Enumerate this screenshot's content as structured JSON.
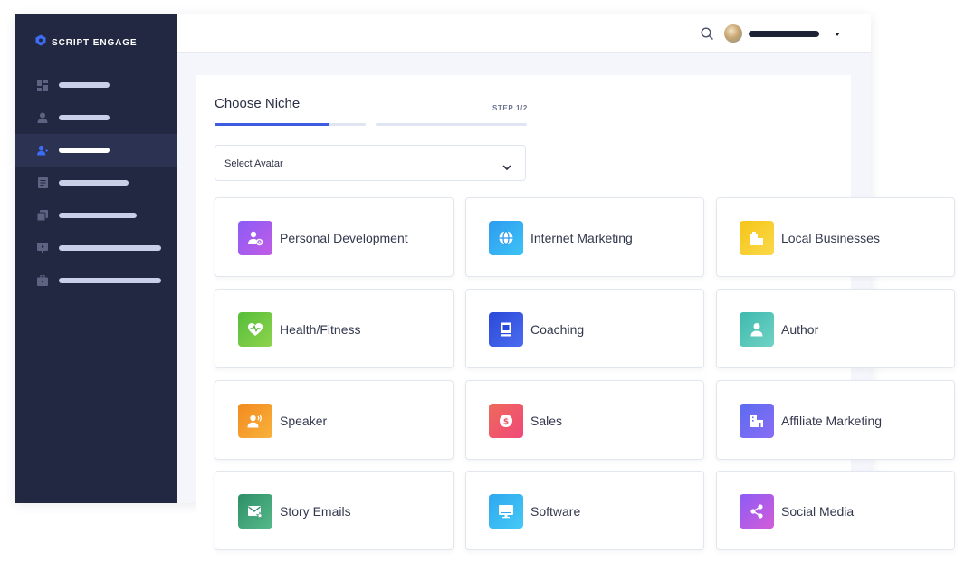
{
  "brand": {
    "name": "SCRIPT ENGAGE",
    "icon": "hexagon-logo-icon",
    "color": "#3d6cf5"
  },
  "sidebar": {
    "items": [
      {
        "icon": "dashboard-icon",
        "active": false
      },
      {
        "icon": "user-icon",
        "active": false
      },
      {
        "icon": "add-user-icon",
        "active": true
      },
      {
        "icon": "document-icon",
        "active": false
      },
      {
        "icon": "copy-icon",
        "active": false
      },
      {
        "icon": "presentation-icon",
        "active": false
      },
      {
        "icon": "briefcase-icon",
        "active": false
      }
    ]
  },
  "header": {
    "search_icon": "search-icon",
    "user_menu_icon": "caret-down-icon"
  },
  "main": {
    "title": "Choose Niche",
    "step_label": "STEP 1/2",
    "progress": [
      0.76,
      0
    ],
    "select": {
      "placeholder": "Select Avatar",
      "icon": "chevron-down-icon"
    },
    "niches": [
      {
        "label": "Personal Development",
        "icon": "user-gear-icon",
        "colors": [
          "#8b5cf6",
          "#c15ce6"
        ]
      },
      {
        "label": "Internet Marketing",
        "icon": "globe-icon",
        "colors": [
          "#2e9bf0",
          "#3cc3f5"
        ]
      },
      {
        "label": "Local Businesses",
        "icon": "building-icon",
        "colors": [
          "#f5c518",
          "#fbd94a"
        ]
      },
      {
        "label": "Health/Fitness",
        "icon": "heart-pulse-icon",
        "colors": [
          "#56bd3a",
          "#8fd44e"
        ]
      },
      {
        "label": "Coaching",
        "icon": "book-icon",
        "colors": [
          "#2b49d8",
          "#4a6cf0"
        ]
      },
      {
        "label": "Author",
        "icon": "person-icon",
        "colors": [
          "#3fb9ae",
          "#6fd3c4"
        ]
      },
      {
        "label": "Speaker",
        "icon": "speaker-person-icon",
        "colors": [
          "#f28a1f",
          "#f8b23c"
        ]
      },
      {
        "label": "Sales",
        "icon": "dollar-coin-icon",
        "colors": [
          "#ee6a5a",
          "#f0487a"
        ]
      },
      {
        "label": "Affiliate Marketing",
        "icon": "office-building-icon",
        "colors": [
          "#5a6cf0",
          "#8a6cf5"
        ]
      },
      {
        "label": "Story Emails",
        "icon": "mail-star-icon",
        "colors": [
          "#2e8f67",
          "#56b98a"
        ]
      },
      {
        "label": "Software",
        "icon": "monitor-icon",
        "colors": [
          "#2ea8f0",
          "#45c9f5"
        ]
      },
      {
        "label": "Social Media",
        "icon": "share-icon",
        "colors": [
          "#8b5cf6",
          "#d45cd8"
        ]
      }
    ]
  }
}
